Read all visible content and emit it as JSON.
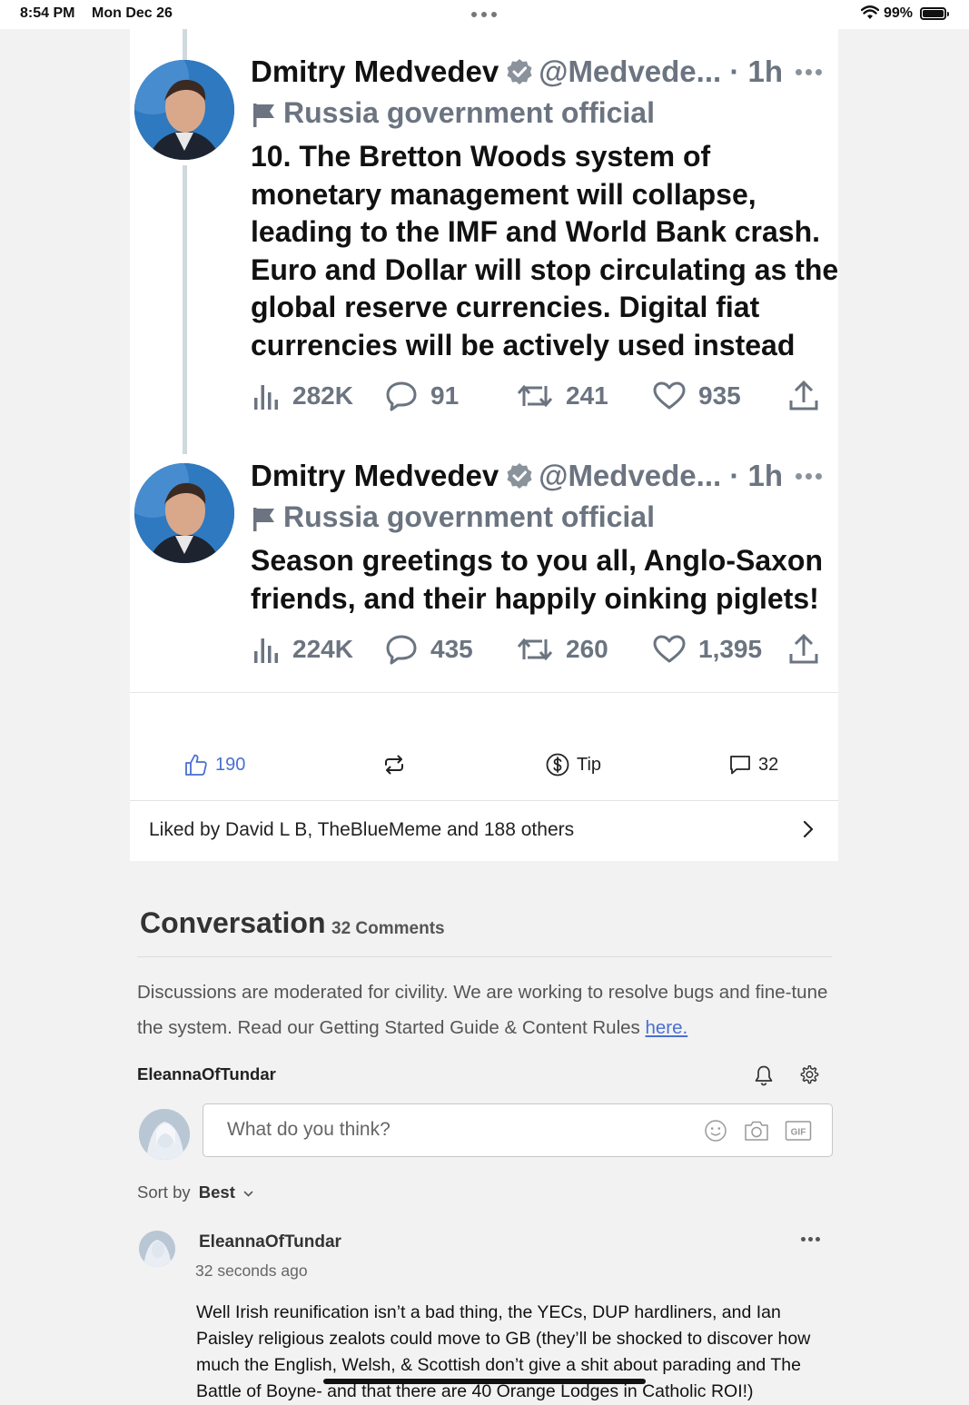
{
  "status_bar": {
    "time": "8:54 PM",
    "date": "Mon Dec 26",
    "battery": "99%",
    "battery_level": 0.99
  },
  "tweets": [
    {
      "name": "Dmitry Medvedev",
      "handle": "@Medvede... · 1h",
      "label": "Russia government official",
      "text": "10. The Bretton Woods system of monetary management will collapse, leading to the IMF and World Bank crash. Euro and Dollar will stop circulating as the global reserve currencies. Digital fiat currencies will be actively used instead",
      "views": "282K",
      "replies": "91",
      "retweets": "241",
      "likes": "935"
    },
    {
      "name": "Dmitry Medvedev",
      "handle": "@Medvede... · 1h",
      "label": "Russia government official",
      "text": "Season greetings to you all, Anglo-Saxon friends, and their happily oinking piglets!",
      "views": "224K",
      "replies": "435",
      "retweets": "260",
      "likes": "1,395"
    }
  ],
  "post_actions": {
    "likes": "190",
    "tip_label": "Tip",
    "comments": "32"
  },
  "liked_by": "Liked by David L B, TheBlueMeme and 188 others",
  "conversation": {
    "title": "Conversation",
    "count": "32 Comments",
    "note": "Discussions are moderated for civility. We are working to resolve bugs and fine-tune the system. Read our Getting Started Guide & Content Rules ",
    "note_link": "here.",
    "current_user": "EleannaOfTundar",
    "input_placeholder": "What do you think?",
    "sort_label": "Sort by",
    "sort_value": "Best"
  },
  "comments": [
    {
      "author": "EleannaOfTundar",
      "time": "32 seconds ago",
      "text": "Well Irish reunification isn’t a bad thing, the YECs, DUP hardliners, and Ian Paisley religious zealots could move to GB (they’ll be shocked to discover how much the English, Welsh, & Scottish don’t give a shit about parading and The Battle of Boyne- and that there are 40 Orange Lodges in Catholic ROI!)"
    }
  ],
  "colors": {
    "accent": "#4a6fd1",
    "muted_text": "#6b7480",
    "verified": "#8a939c"
  }
}
